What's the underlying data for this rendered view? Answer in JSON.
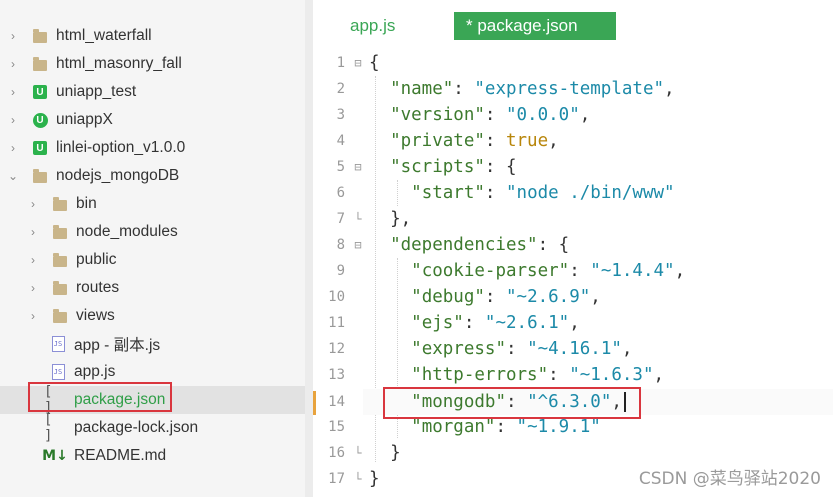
{
  "sidebar": {
    "items": [
      {
        "label": "html_waterfall",
        "icon": "folder-icon",
        "chevron": "›"
      },
      {
        "label": "html_masonry_fall",
        "icon": "folder-icon",
        "chevron": "›"
      },
      {
        "label": "uniapp_test",
        "icon": "uniapp-icon",
        "chevron": "›"
      },
      {
        "label": "uniappX",
        "icon": "uniappx-icon",
        "chevron": "›"
      },
      {
        "label": "linlei-option_v1.0.0",
        "icon": "uniapp-icon",
        "chevron": "›"
      },
      {
        "label": "nodejs_mongoDB",
        "icon": "folder-icon",
        "chevron": "⌄"
      },
      {
        "label": "bin",
        "icon": "folder-icon",
        "chevron": "›"
      },
      {
        "label": "node_modules",
        "icon": "folder-icon",
        "chevron": "›"
      },
      {
        "label": "public",
        "icon": "folder-icon",
        "chevron": "›"
      },
      {
        "label": "routes",
        "icon": "folder-icon",
        "chevron": "›"
      },
      {
        "label": "views",
        "icon": "folder-icon",
        "chevron": "›"
      },
      {
        "label": "app - 副本.js",
        "icon": "js-file-icon",
        "chevron": ""
      },
      {
        "label": "app.js",
        "icon": "js-file-icon",
        "chevron": ""
      },
      {
        "label": "package.json",
        "icon": "json-file-icon",
        "chevron": ""
      },
      {
        "label": "package-lock.json",
        "icon": "json-file-icon",
        "chevron": ""
      },
      {
        "label": "README.md",
        "icon": "markdown-file-icon",
        "chevron": ""
      }
    ],
    "selected_label": "package.json",
    "js_glyph": "JS",
    "json_glyph": "[ ]",
    "md_glyph": "M↓",
    "u_glyph": "U"
  },
  "tabs": [
    {
      "label": "app.js"
    },
    {
      "label": "* package.json"
    }
  ],
  "editor": {
    "line_numbers": [
      "1",
      "2",
      "3",
      "4",
      "5",
      "6",
      "7",
      "8",
      "9",
      "10",
      "11",
      "12",
      "13",
      "14",
      "15",
      "16",
      "17"
    ],
    "fold_markers": {
      "open": "⊟",
      "close": "└"
    }
  },
  "code": {
    "l1": "{",
    "name_key": "\"name\"",
    "name_val": "\"express-template\"",
    "version_key": "\"version\"",
    "version_val": "\"0.0.0\"",
    "private_key": "\"private\"",
    "private_val": "true",
    "scripts_key": "\"scripts\"",
    "start_key": "\"start\"",
    "start_val": "\"node ./bin/www\"",
    "deps_key": "\"dependencies\"",
    "cookie_key": "\"cookie-parser\"",
    "cookie_val": "\"~1.4.4\"",
    "debug_key": "\"debug\"",
    "debug_val": "\"~2.6.9\"",
    "ejs_key": "\"ejs\"",
    "ejs_val": "\"~2.6.1\"",
    "express_key": "\"express\"",
    "express_val": "\"~4.16.1\"",
    "httperr_key": "\"http-errors\"",
    "httperr_val": "\"~1.6.3\"",
    "mongodb_key": "\"mongodb\"",
    "mongodb_val": "\"^6.3.0\"",
    "morgan_key": "\"morgan\"",
    "morgan_val": "\"~1.9.1\""
  },
  "watermark": "CSDN @菜鸟驿站2020",
  "colors": {
    "accent_green": "#3aa655",
    "highlight_red": "#d9363e",
    "key_green": "#3d7a2e",
    "string_teal": "#1c8aa8",
    "bool_gold": "#b8860b"
  }
}
